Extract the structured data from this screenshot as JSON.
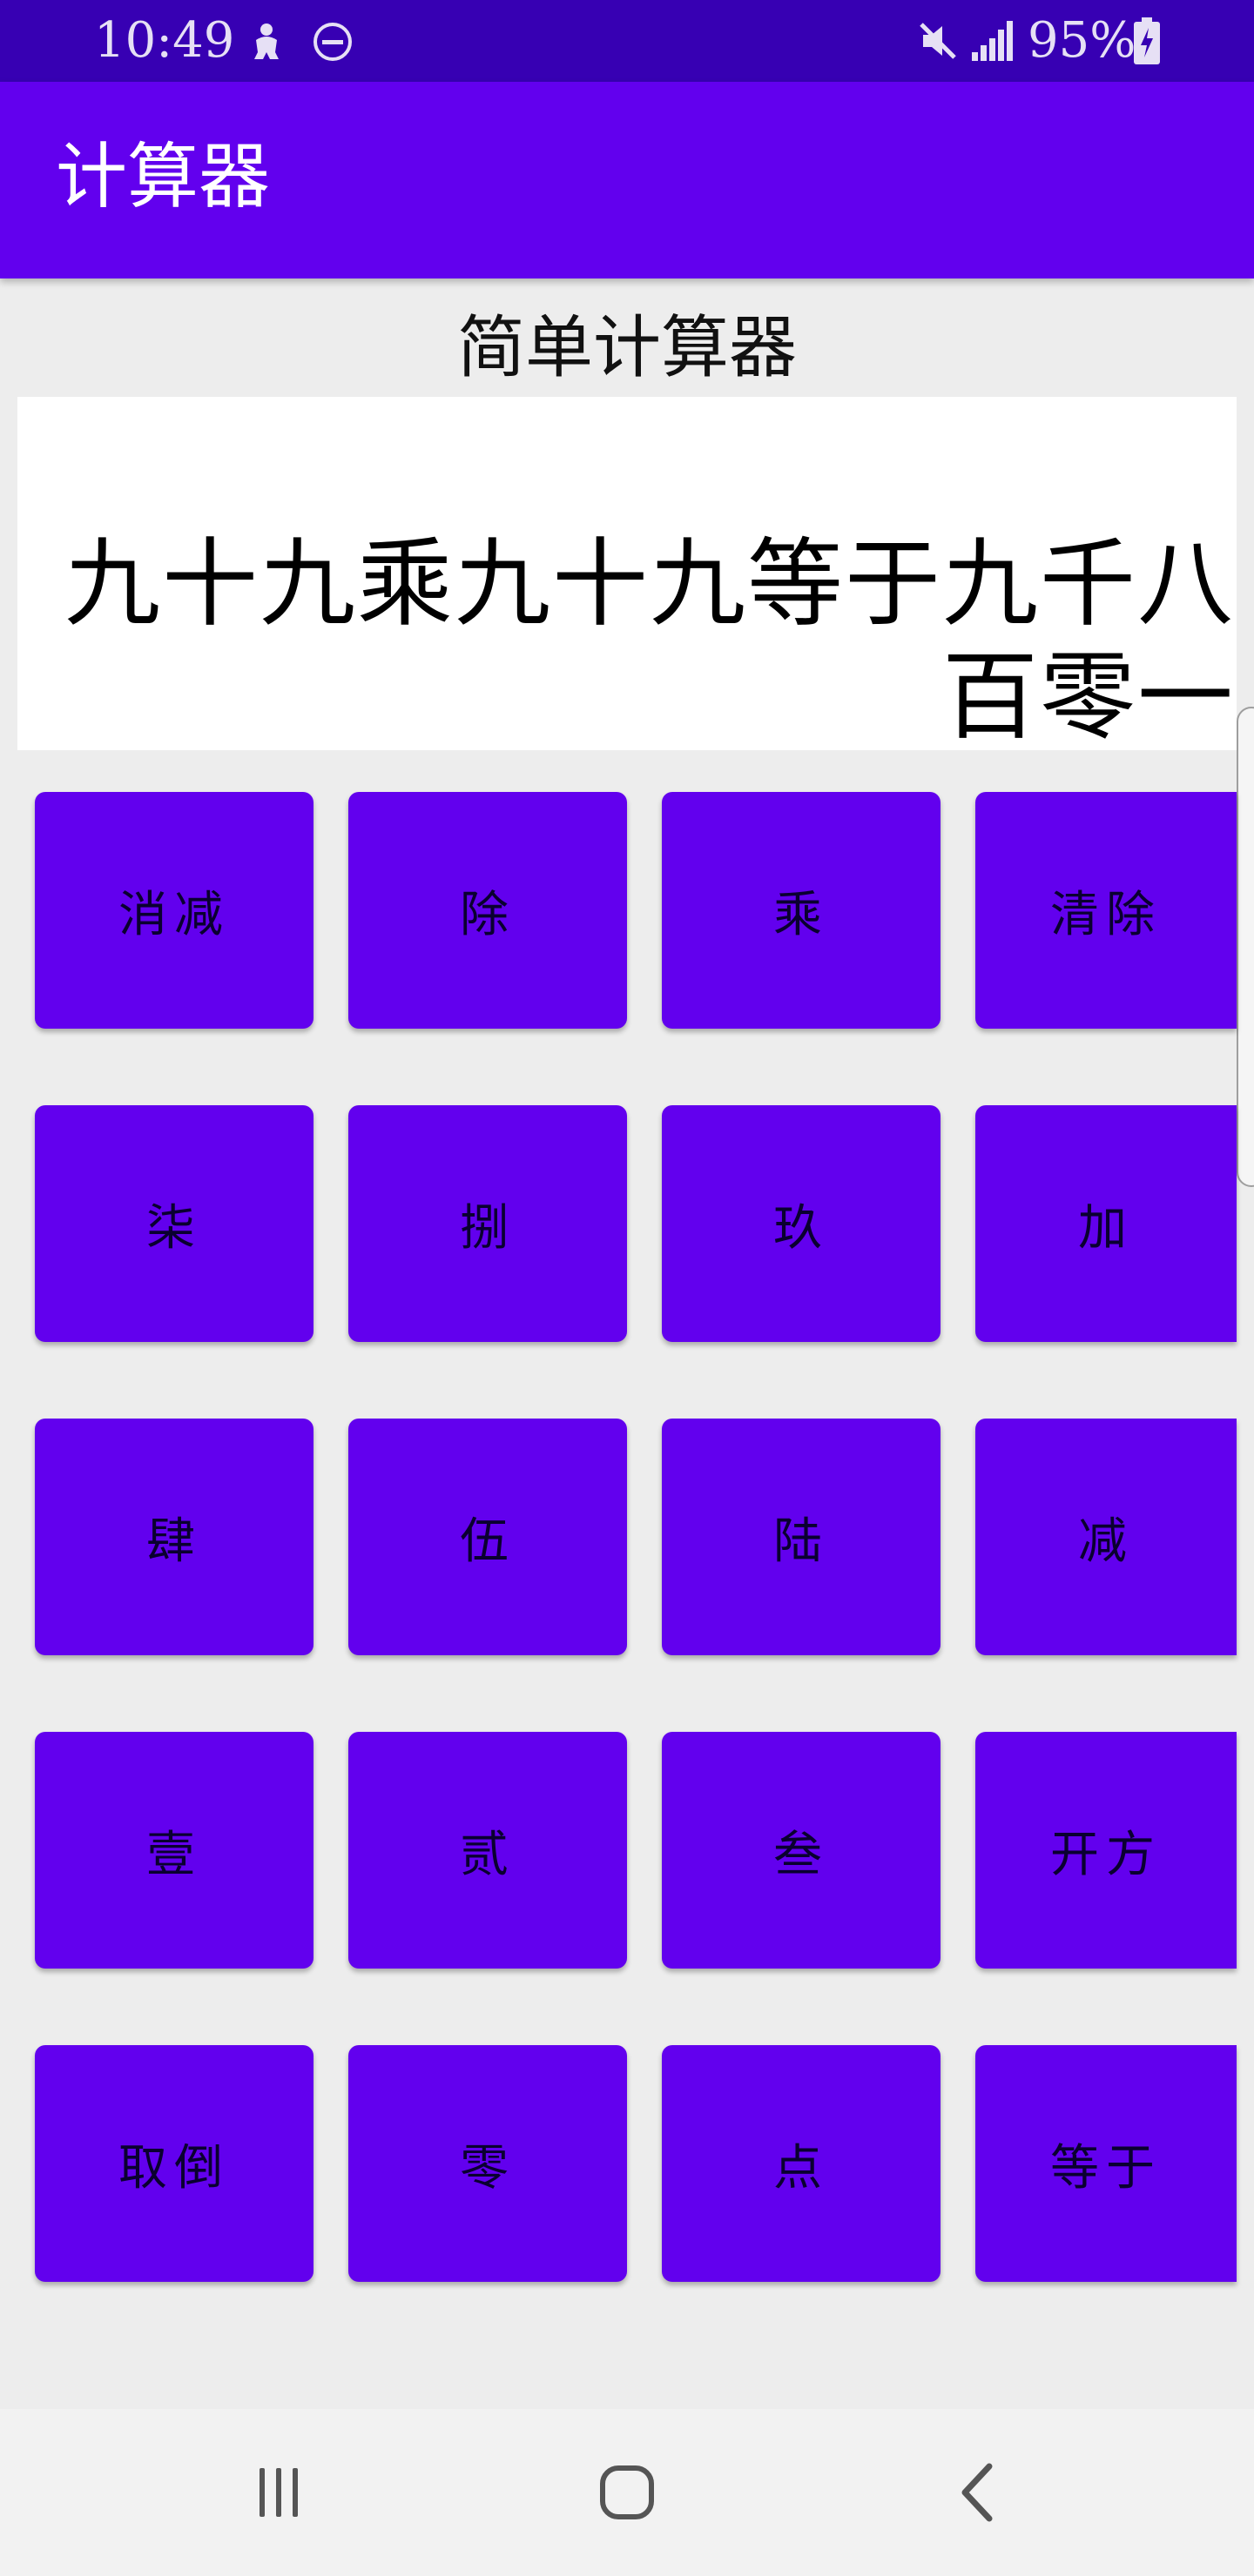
{
  "status_bar": {
    "time": "10:49",
    "battery": "95%",
    "icons": [
      "android-person-icon",
      "do-not-disturb-icon",
      "mute-icon",
      "signal-icon",
      "battery-charging-icon"
    ]
  },
  "app_bar": {
    "title": "计算器"
  },
  "page": {
    "title": "简单计算器",
    "display": "九十九乘九十九等于九千八百零一"
  },
  "keypad": {
    "rows": [
      [
        "消减",
        "除",
        "乘",
        "清除"
      ],
      [
        "柒",
        "捌",
        "玖",
        "加"
      ],
      [
        "肆",
        "伍",
        "陆",
        "减"
      ],
      [
        "壹",
        "贰",
        "叁",
        "开方"
      ],
      [
        "取倒",
        "零",
        "点",
        "等于"
      ]
    ]
  },
  "nav_bar": {
    "buttons": [
      "recent-apps-icon",
      "home-icon",
      "back-icon"
    ]
  },
  "colors": {
    "status_bar": "#3700b3",
    "primary": "#6200ee",
    "background": "#ededed"
  }
}
